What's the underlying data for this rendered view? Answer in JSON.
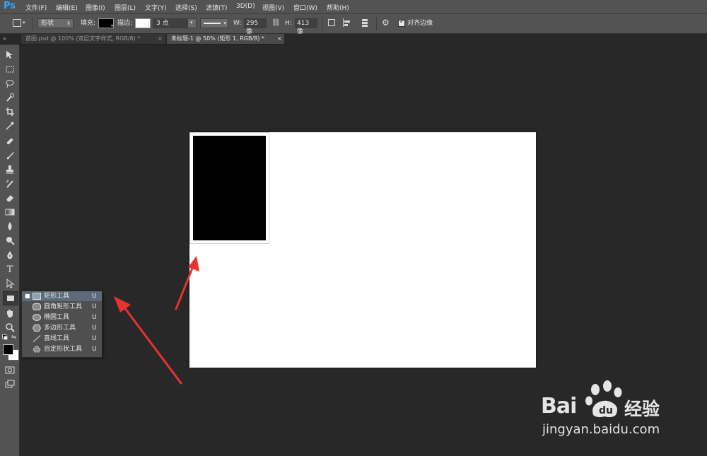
{
  "app": {
    "logo": "Ps"
  },
  "menu": [
    "文件(F)",
    "编辑(E)",
    "图像(I)",
    "图层(L)",
    "文字(Y)",
    "选择(S)",
    "滤镜(T)",
    "3D(D)",
    "视图(V)",
    "窗口(W)",
    "帮助(H)"
  ],
  "options": {
    "mode": "形状",
    "fill_label": "填充:",
    "stroke_label": "描边:",
    "stroke_width": "3 点",
    "w_label": "W:",
    "w_value": "295 像",
    "h_label": "H:",
    "h_value": "413 像",
    "align_edges_label": "对齐边缘",
    "align_edges_checked": true
  },
  "tabs": [
    {
      "label": "首图.psd @ 100% (双层文字样式, RGB/8) *",
      "active": false,
      "close": "×"
    },
    {
      "label": "未标题-1 @ 50% (矩形 1, RGB/8) *",
      "active": true,
      "close": "×"
    }
  ],
  "tools": [
    "move-icon",
    "marquee-icon",
    "lasso-icon",
    "quick-select-icon",
    "crop-icon",
    "eyedropper-icon",
    "healing-icon",
    "brush-icon",
    "stamp-icon",
    "history-brush-icon",
    "eraser-icon",
    "gradient-icon",
    "blur-icon",
    "dodge-icon",
    "pen-icon",
    "type-icon",
    "path-select-icon",
    "rectangle-icon",
    "hand-icon",
    "zoom-icon"
  ],
  "flyout": {
    "items": [
      {
        "label": "矩形工具",
        "key": "U",
        "selected": true,
        "icon": "rectangle-icon"
      },
      {
        "label": "圆角矩形工具",
        "key": "U",
        "selected": false,
        "icon": "rounded-rectangle-icon"
      },
      {
        "label": "椭圆工具",
        "key": "U",
        "selected": false,
        "icon": "ellipse-icon"
      },
      {
        "label": "多边形工具",
        "key": "U",
        "selected": false,
        "icon": "polygon-icon"
      },
      {
        "label": "直线工具",
        "key": "U",
        "selected": false,
        "icon": "line-icon"
      },
      {
        "label": "自定形状工具",
        "key": "U",
        "selected": false,
        "icon": "custom-shape-icon"
      }
    ]
  },
  "colors": {
    "foreground": "#000000",
    "background": "#ffffff",
    "arrow": "#e8322d",
    "accent_blue": "#31a8ff"
  },
  "watermark": {
    "brand_text": "Bai",
    "brand_suffix": "经验",
    "url": "jingyan.baidu.com"
  }
}
